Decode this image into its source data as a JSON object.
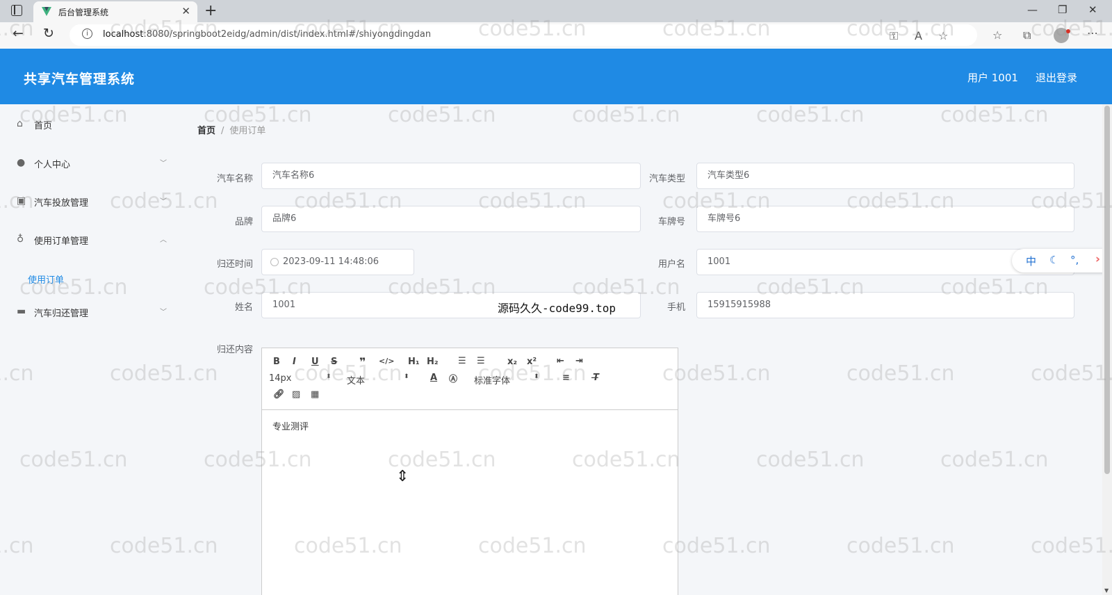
{
  "browser": {
    "tab_title": "后台管理系统",
    "url_host": "localhost",
    "url_rest": ":8080/springboot2eidg/admin/dist/index.html#/shiyongdingdan"
  },
  "header": {
    "title": "共享汽车管理系统",
    "user": "用户 1001",
    "logout": "退出登录"
  },
  "sidebar": {
    "items": [
      {
        "label": "首页",
        "icon": "home-icon"
      },
      {
        "label": "个人中心",
        "icon": "user-icon"
      },
      {
        "label": "汽车投放管理",
        "icon": "clipboard-icon"
      },
      {
        "label": "使用订单管理",
        "icon": "microphone-icon"
      },
      {
        "label": "汽车归还管理",
        "icon": "card-icon"
      }
    ],
    "active_sub": "使用订单"
  },
  "breadcrumb": {
    "home": "首页",
    "separator": "/",
    "current": "使用订单"
  },
  "form": {
    "car_name": {
      "label": "汽车名称",
      "value": "汽车名称6"
    },
    "car_type": {
      "label": "汽车类型",
      "value": "汽车类型6"
    },
    "brand": {
      "label": "品牌",
      "value": "品牌6"
    },
    "plate": {
      "label": "车牌号",
      "value": "车牌号6"
    },
    "return_time": {
      "label": "归还时间",
      "value": "2023-09-11 14:48:06"
    },
    "username": {
      "label": "用户名",
      "value": "1001"
    },
    "name": {
      "label": "姓名",
      "value": "1001"
    },
    "phone": {
      "label": "手机",
      "value": "15915915988"
    },
    "content": {
      "label": "归还内容",
      "value": "专业测评"
    }
  },
  "editor": {
    "font_size": "14px",
    "heading": "文本",
    "font_family": "标准字体"
  },
  "promo_text": "源码久久-code99.top",
  "ime": {
    "lang": "中"
  },
  "watermark": "code51.cn"
}
